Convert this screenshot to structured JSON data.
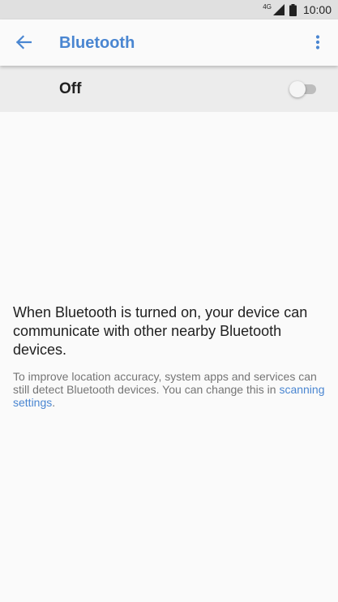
{
  "status_bar": {
    "network": "4G",
    "time": "10:00"
  },
  "app_bar": {
    "title": "Bluetooth",
    "back_icon": "arrow-back-icon",
    "menu_icon": "more-vert-icon",
    "accent_color": "#4a86d1"
  },
  "master_switch": {
    "label": "Off",
    "state": "off"
  },
  "empty_state": {
    "message": "When Bluetooth is turned on, your device can communicate with other nearby Bluetooth devices.",
    "footer_prefix": "To improve location accuracy, system apps and services can still detect Bluetooth devices. You can change this in ",
    "footer_link": "scanning settings",
    "footer_suffix": "."
  }
}
